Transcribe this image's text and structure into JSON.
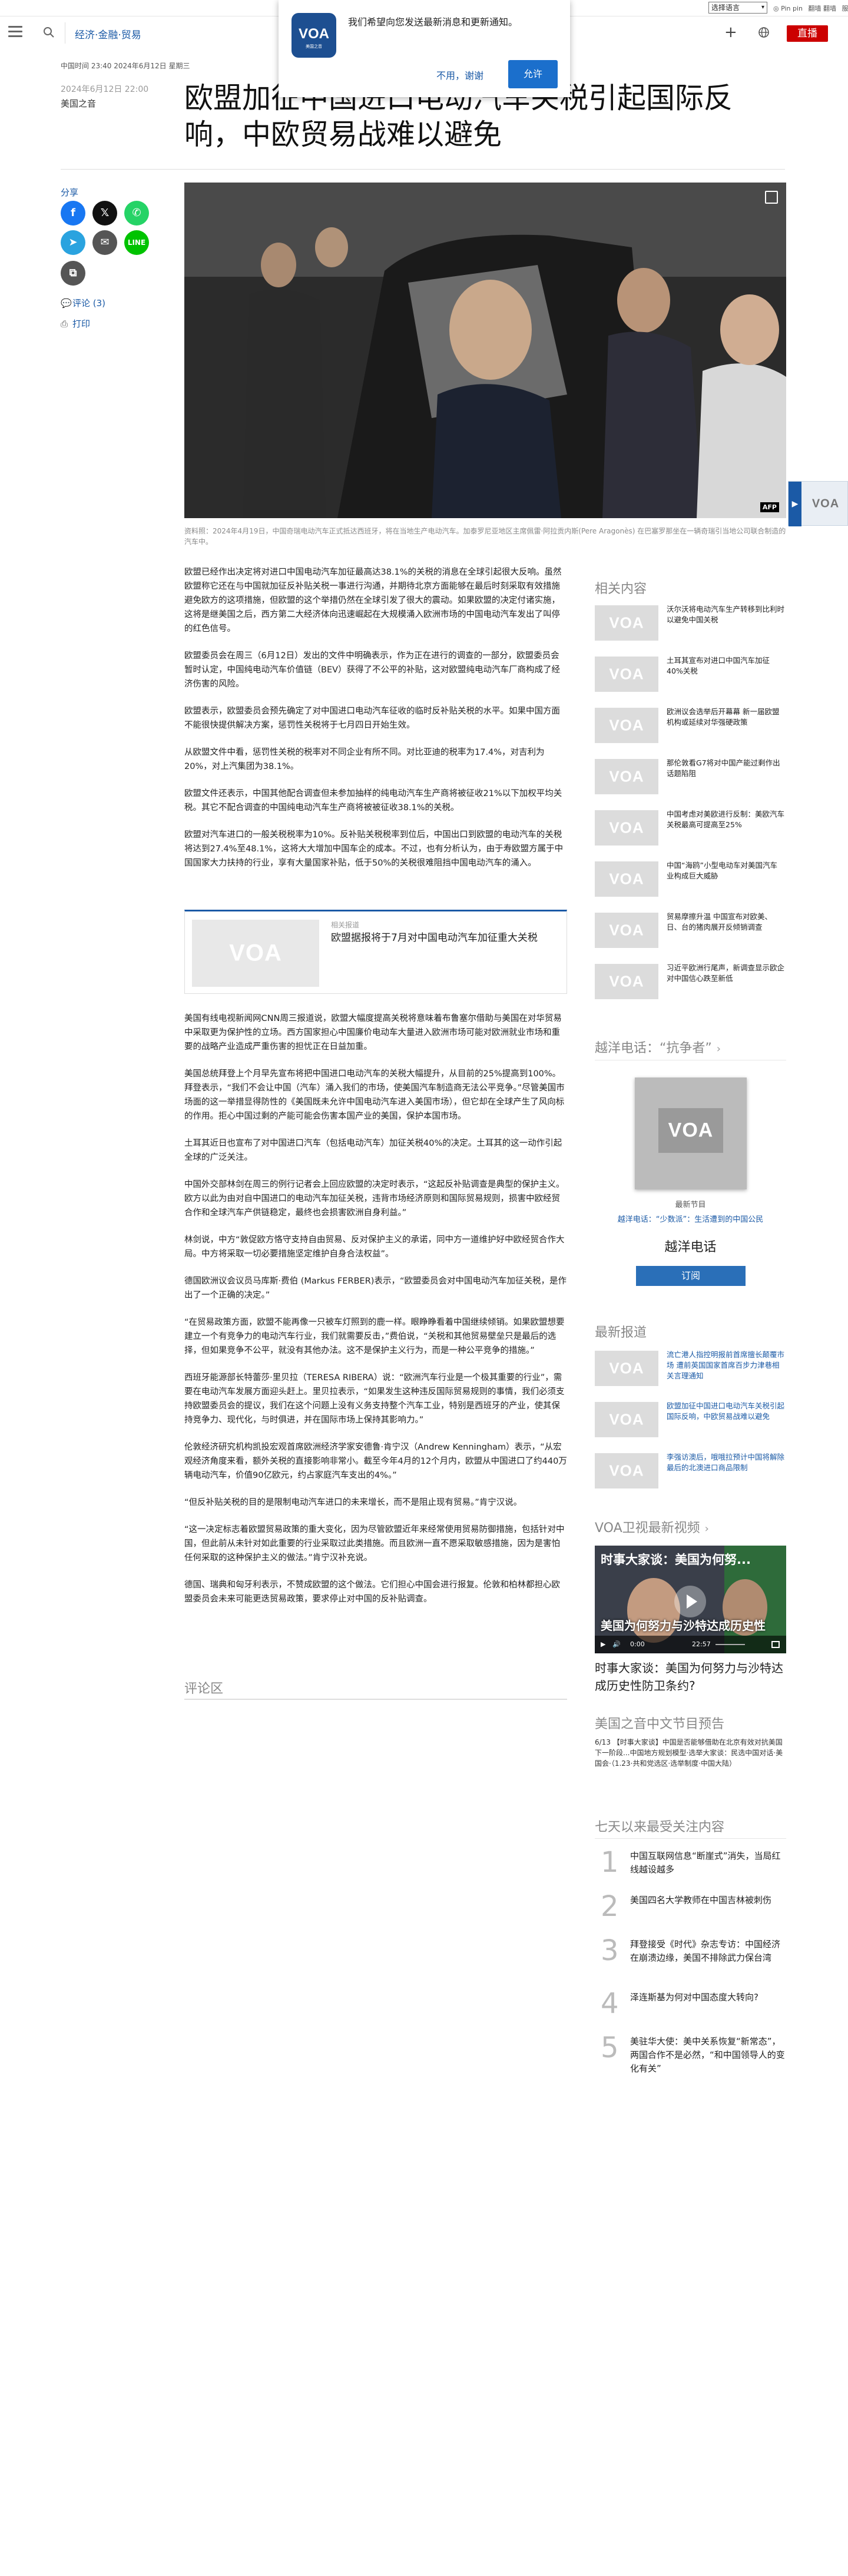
{
  "topbar": {
    "language_select": "选择语言",
    "links": [
      "◎ Pin pin",
      "翻墙 翻墙",
      "服务/文化"
    ]
  },
  "header": {
    "section": "经济·金融·贸易",
    "live_label": "直播"
  },
  "popup": {
    "logo_text": "VOA",
    "logo_sub": "美国之音",
    "message": "我们希望向您发送最新消息和更新通知。",
    "later_label": "不用，谢谢",
    "allow_label": "允许"
  },
  "article": {
    "meta_time": "中国时间 23:40 2024年6月12日 星期三",
    "date": "2024年6月12日 22:00",
    "author": "美国之音",
    "title": "欧盟加征中国进口电动汽车关税引起国际反响，中欧贸易战难以避免",
    "share_label": "分享",
    "comments_link": "评论 (3)",
    "print_link": "打印",
    "caption": "资料照：2024年4月19日，中国奇瑞电动汽车正式抵达西班牙，将在当地生产电动汽车。加泰罗尼亚地区主席佩雷·阿拉贡内斯(Pere Aragonès) 在巴塞罗那坐在一辆奇瑞引当地公司联合制造的汽车中。",
    "paragraphs_a": [
      "欧盟已经作出决定将对进口中国电动汽车加征最高达38.1%的关税的消息在全球引起很大反响。虽然欧盟称它还在与中国就加征反补贴关税一事进行沟通，并期待北京方面能够在最后时刻采取有效措施避免欧方的这项措施，但欧盟的这个举措仍然在全球引发了很大的震动。如果欧盟的决定付诸实施，这将是继美国之后，西方第二大经济体向迅速崛起在大规模涌入欧洲市场的中国电动汽车发出了叫停的红色信号。",
      "欧盟委员会在周三（6月12日）发出的文件中明确表示，作为正在进行的调查的一部分，欧盟委员会暂时认定，中国纯电动汽车价值链（BEV）获得了不公平的补贴，这对欧盟纯电动汽车厂商构成了经济伤害的风险。",
      "欧盟表示，欧盟委员会预先确定了对中国进口电动汽车征收的临时反补贴关税的水平。如果中国方面不能很快提供解决方案，惩罚性关税将于七月四日开始生效。",
      "从欧盟文件中看，惩罚性关税的税率对不同企业有所不同。对比亚迪的税率为17.4%，对吉利为20%，对上汽集团为38.1%。",
      "欧盟文件还表示，中国其他配合调查但未参加抽样的纯电动汽车生产商将被征收21%以下加权平均关税。其它不配合调查的中国纯电动汽车生产商将被被征收38.1%的关税。",
      "欧盟对汽车进口的一般关税税率为10%。反补贴关税税率到位后，中国出口到欧盟的电动汽车的关税将达到27.4%至48.1%，这将大大增加中国车企的成本。不过，也有分析认为，由于寿欧盟方属于中国国家大力扶持的行业，享有大量国家补贴，低于50%的关税很难阻挡中国电动汽车的涌入。"
    ],
    "related": {
      "kicker": "相关报道",
      "title": "欧盟据报将于7月对中国电动汽车加征重大关税"
    },
    "paragraphs_b": [
      "美国有线电视新闻网CNN周三报道说，欧盟大幅度提高关税将意味着布鲁塞尔借助与美国在对华贸易中采取更为保护性的立场。西方国家担心中国廉价电动车大量进入欧洲市场可能对欧洲就业市场和重要的战略产业造成严重伤害的担忧正在日益加重。",
      "美国总统拜登上个月早先宣布将把中国进口电动汽车的关税大幅提升，从目前的25%提高到100%。拜登表示，“我们不会让中国（汽车）涌入我们的市场，使美国汽车制造商无法公平竞争。”尽管美国市场面的这一举措显得防性的《美国既未允许中国电动汽车进入美国市场），但它却在全球产生了风向标的作用。拒心中国过剩的产能可能会伤害本国产业的美国，保护本国市场。",
      "土耳其近日也宣布了对中国进口汽车（包括电动汽车）加征关税40%的决定。土耳其的这一动作引起全球的广泛关注。",
      "中国外交部林剑在周三的例行记者会上回应欧盟的决定时表示，“这起反补贴调查是典型的保护主义。欧方以此为由对自中国进口的电动汽车加征关税，违背市场经济原则和国际贸易规则，损害中欧经贸合作和全球汽车产供链稳定，最终也会损害欧洲自身利益。”",
      "林剑说，中方“敦促欧方恪守支持自由贸易、反对保护主义的承诺，同中方一道维护好中欧经贸合作大局。中方将采取一切必要措施坚定维护自身合法权益”。",
      "德国欧洲议会议员马库斯·费伯 (Markus FERBER)表示，“欧盟委员会对中国电动汽车加征关税，是作出了一个正确的决定。”",
      "“在贸易政策方面，欧盟不能再像一只被车灯照到的鹿一样。眼睁睁看着中国继续倾销。如果欧盟想要建立一个有竞争力的电动汽车行业，我们就需要反击，”费伯说，“关税和其他贸易壁垒只是最后的选择，但如果竞争不公平，就没有其他办法。这不是保护主义行为，而是一种公平竞争的措施。”",
      "西班牙能源部长特蕾莎·里贝拉（TERESA RIBERA）说：“欧洲汽车行业是一个极其重要的行业”，需要在电动汽车发展方面迎头赶上。里贝拉表示，“如果发生这种违反国际贸易规则的事情，我们必须支持欧盟委员会的提议，我们在这个问题上没有义务支持整个汽车工业，特别是西班牙的产业，使其保持竞争力、现代化，与时俱进，并在国际市场上保持其影响力。”",
      "伦敦经济研究机构凯投宏观首席欧洲经济学家安德鲁·肯宁汉（Andrew Kenningham）表示，“从宏观经济角度来看，额外关税的直接影响非常小。截至今年4月的12个月内，欧盟从中国进口了约440万辆电动汽车，价值90亿欧元，约占家庭汽车支出的4%。”",
      "“但反补贴关税的目的是限制电动汽车进口的未来增长，而不是阻止现有贸易。”肯宁汉说。",
      "“这一决定标志着欧盟贸易政策的重大变化，因为尽管欧盟近年来经常使用贸易防御措施，包括针对中国，但此前从未针对如此重要的行业采取过此类措施。而且欧洲一直不愿采取敏感措施，因为是害怕任何采取的这种保护主义的做法。”肯宁汉补充说。",
      "德国、瑞典和匈牙利表示，不赞成欧盟的这个做法。它们担心中国会进行报复。伦敦和柏林都担心欧盟委员会未来可能更迭贸易政策，要求停止对中国的反补贴调查。"
    ],
    "comments_heading": "评论区"
  },
  "sidebar": {
    "related_heading": "相关内容",
    "related_items": [
      "沃尔沃将电动汽车生产转移到比利时以避免中国关税",
      "土耳其宣布对进口中国汽车加征40%关税",
      "欧洲议会选举后开幕幕 新一届欧盟机构或延续对华强硬政策",
      "那伦敦看G7将对中国产能过剩作出话题陷阻",
      "中国考虑对美欧进行反制：美欧汽车关税最高可提高至25%",
      "中国“海鸥”小型电动车对美国汽车业构成巨大威胁",
      "贸易摩擦升温 中国宣布对欧美、日、台的猪肉展开反倾销调查",
      "习近平欧洲行尾声，新调查显示欧企对中国信心跌至新低"
    ],
    "podcast_heading": "越洋电话：“抗争者”",
    "podcast_latest": "最新节目",
    "podcast_episode": "越洋电话：“少数派”：生活遭到的中国公民",
    "podcast_name": "越洋电话",
    "subscribe_label": "订阅",
    "latest_heading": "最新报道",
    "latest_items": [
      "流亡港人指控明报前首席擅长颠覆市场 遭前英国国家首席百步力津巷相关言理通知",
      "欧盟加征中国进口电动汽车关税引起国际反响，中欧贸易战难以避免",
      "李强访澳后，哦哦拉预计中国将解除最后的北澳进口商品限制"
    ],
    "video_heading": "VOA卫视最新视频",
    "video_overlay_title": "时事大家谈：美国为何努...",
    "video_overlay_text": "美国为何努力与沙特达成历史性",
    "video_time_current": "0:00",
    "video_time_total": "22:57",
    "video_caption": "时事大家谈：美国为何努力与沙特达成历史性防卫条约?",
    "schedule_heading": "美国之音中文节目预告",
    "schedule_text": "6/13 【时事大家谈】中国是否能够借助在北京有效对抗美国下一阶段...中国地方规划模型·选举大家谈：民选中国对话·美国会·（1.23·共和党选区·选举制度·中国大陆）",
    "top7_heading": "七天以来最受关注内容",
    "top7_items": [
      "中国互联网信息“断崖式”消失，当局红线越设越多",
      "美国四名大学教师在中国吉林被刺伤",
      "拜登接受《时代》杂志专访：中国经济在崩溃边缘，美国不排除武力保台湾",
      "泽连斯基为何对中国态度大转向?",
      "美驻华大使：美中关系恢复“新常态”，两国合作不是必然，“和中国领导人的变化有关”"
    ]
  }
}
